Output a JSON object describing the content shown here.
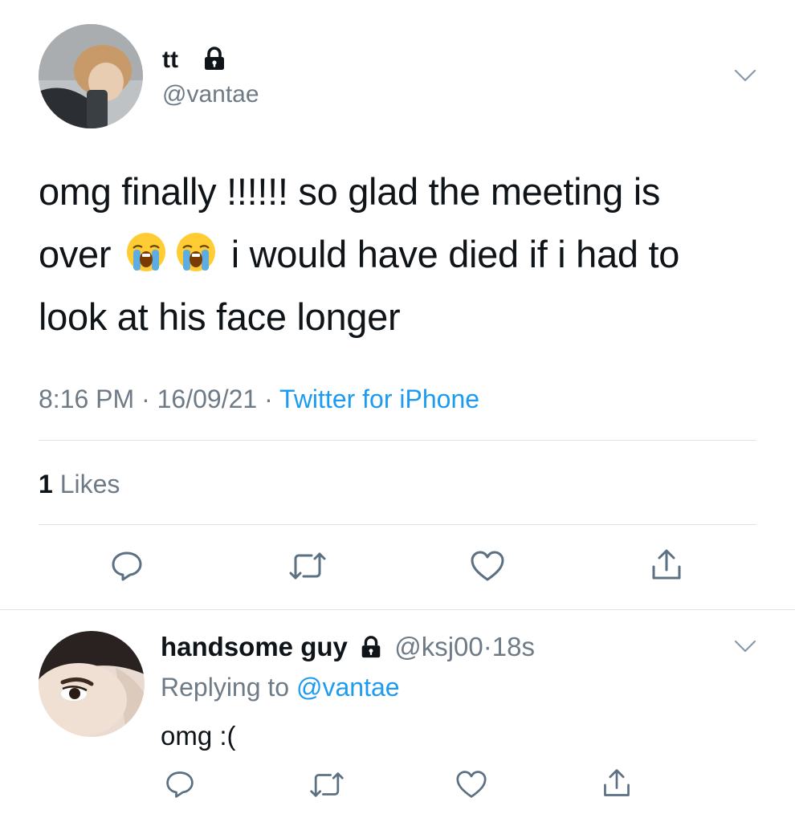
{
  "main_tweet": {
    "display_name": "tt",
    "handle": "@vantae",
    "body": {
      "line1": "omg finally !!!!!! so glad the meeting is",
      "line2_before": "over",
      "line2_emoji": "loudly-crying-face-emoji",
      "line2_after": "i would have died if i had to",
      "line3": "look at his face longer"
    },
    "meta": {
      "time": "8:16 PM",
      "sep1": "·",
      "date": "16/09/21",
      "sep2": "·",
      "source": "Twitter for iPhone"
    },
    "stats": {
      "likes_count": "1",
      "likes_label": "Likes"
    }
  },
  "reply": {
    "display_name": "handsome guy",
    "handle": "@ksj00",
    "sep": "·",
    "age": "18s",
    "replying_label": "Replying to",
    "replying_handle": "@vantae",
    "text": "omg :("
  },
  "colors": {
    "link": "#1d9bf0",
    "muted": "#6e7b87",
    "icon": "#5b7083",
    "divider": "#dfe3e6"
  }
}
